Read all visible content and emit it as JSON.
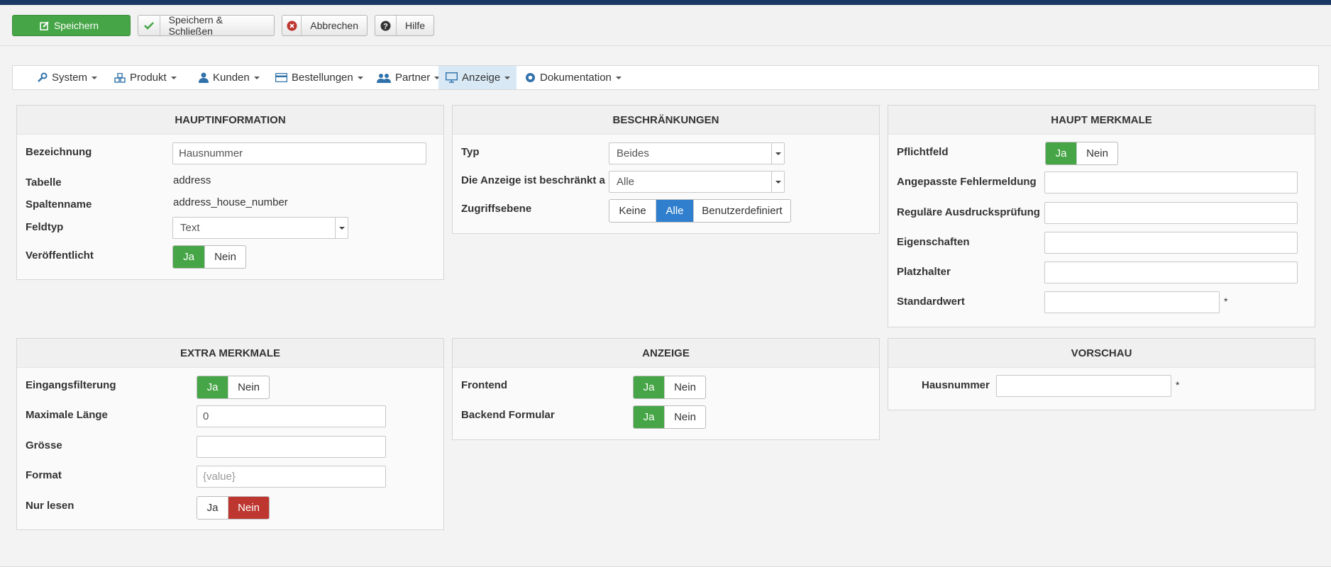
{
  "toolbar": {
    "save": "Speichern",
    "save_close": "Speichern & Schließen",
    "cancel": "Abbrechen",
    "help": "Hilfe"
  },
  "menu": [
    {
      "label": "System",
      "icon": "wrench-icon"
    },
    {
      "label": "Produkt",
      "icon": "cubes-icon"
    },
    {
      "label": "Kunden",
      "icon": "user-icon"
    },
    {
      "label": "Bestellungen",
      "icon": "credit-card-icon"
    },
    {
      "label": "Partner",
      "icon": "users-icon"
    },
    {
      "label": "Anzeige",
      "icon": "monitor-icon",
      "active": true
    },
    {
      "label": "Dokumentation",
      "icon": "lifebuoy-icon"
    }
  ],
  "hauptinformation": {
    "title": "HAUPTINFORMATION",
    "bezeichnung_label": "Bezeichnung",
    "bezeichnung_value": "Hausnummer",
    "tabelle_label": "Tabelle",
    "tabelle_value": "address",
    "spaltenname_label": "Spaltenname",
    "spaltenname_value": "address_house_number",
    "feldtyp_label": "Feldtyp",
    "feldtyp_value": "Text",
    "veroeffentlicht_label": "Veröffentlicht",
    "ja": "Ja",
    "nein": "Nein"
  },
  "beschraenkungen": {
    "title": "BESCHRÄNKUNGEN",
    "typ_label": "Typ",
    "typ_value": "Beides",
    "anzeige_label": "Die Anzeige ist beschränkt a",
    "anzeige_value": "Alle",
    "zugriff_label": "Zugriffsebene",
    "opt_keine": "Keine",
    "opt_alle": "Alle",
    "opt_benutzer": "Benutzerdefiniert"
  },
  "haupt_merkmale": {
    "title": "HAUPT MERKMALE",
    "pflicht_label": "Pflichtfeld",
    "ja": "Ja",
    "nein": "Nein",
    "fehler_label": "Angepasste Fehlermeldung",
    "regex_label": "Reguläre Ausdrucksprüfung",
    "eigenschaften_label": "Eigenschaften",
    "platzhalter_label": "Platzhalter",
    "standard_label": "Standardwert",
    "required_mark": "*"
  },
  "extra_merkmale": {
    "title": "EXTRA MERKMALE",
    "filter_label": "Eingangsfilterung",
    "ja": "Ja",
    "nein": "Nein",
    "maxlen_label": "Maximale Länge",
    "maxlen_value": "0",
    "groesse_label": "Grösse",
    "format_label": "Format",
    "format_placeholder": "{value}",
    "readonly_label": "Nur lesen"
  },
  "anzeige": {
    "title": "ANZEIGE",
    "frontend_label": "Frontend",
    "backend_label": "Backend Formular",
    "ja": "Ja",
    "nein": "Nein"
  },
  "vorschau": {
    "title": "VORSCHAU",
    "label": "Hausnummer",
    "required_mark": "*"
  },
  "colors": {
    "topbar": "#1b3964",
    "green": "#46a546",
    "blue": "#2f7fce",
    "red": "#bd362f",
    "menu_active": "#d8e9f5"
  }
}
